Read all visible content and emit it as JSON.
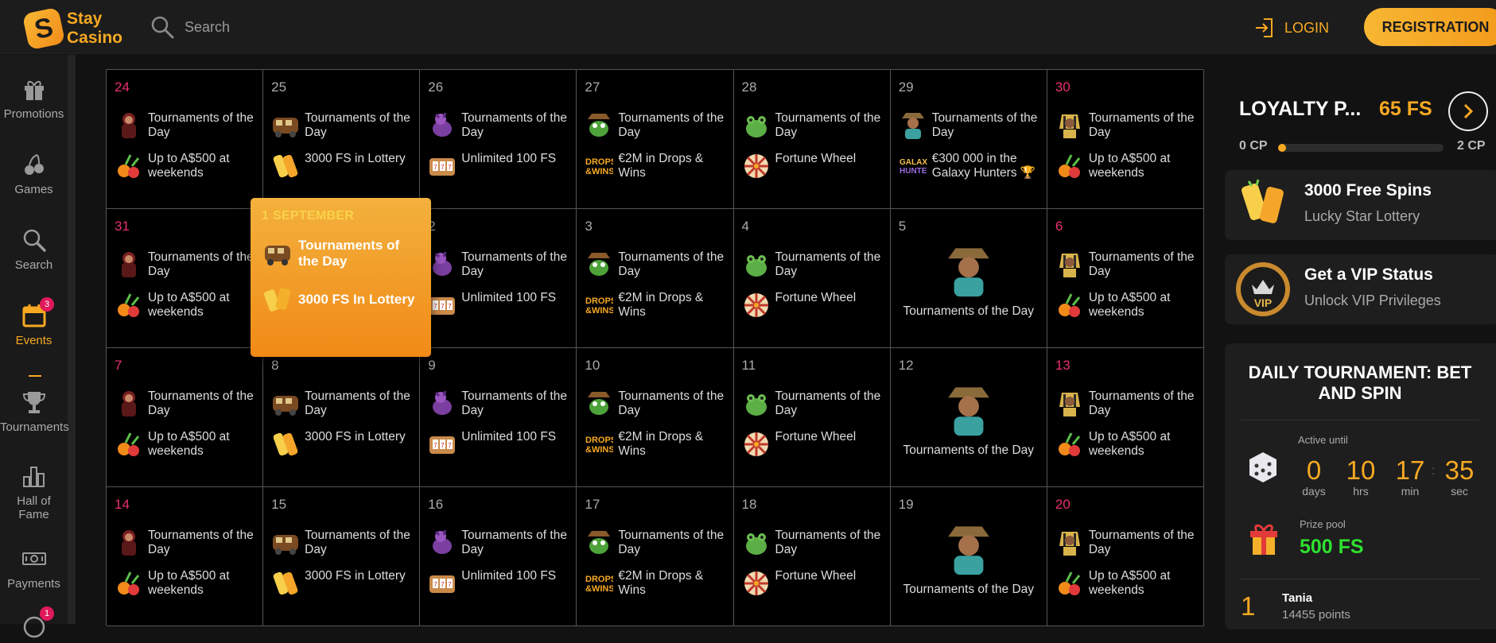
{
  "header": {
    "logo_line1": "Stay",
    "logo_line2": "Casino",
    "search_placeholder": "Search",
    "login_label": "LOGIN",
    "registration_label": "REGISTRATION"
  },
  "sidebar": {
    "items": [
      {
        "label": "Promotions",
        "icon": "gift-icon"
      },
      {
        "label": "Games",
        "icon": "cherries-icon"
      },
      {
        "label": "Search",
        "icon": "search-icon"
      },
      {
        "label": "Events",
        "icon": "calendar-icon",
        "badge": "3",
        "active": true
      },
      {
        "label": "Tournaments",
        "icon": "trophy-icon"
      },
      {
        "label": "Hall of Fame",
        "icon": "bar-chart-icon"
      },
      {
        "label": "Payments",
        "icon": "cash-icon"
      },
      {
        "label": "",
        "icon": "chat-icon",
        "badge": "1"
      }
    ]
  },
  "calendar": {
    "rows": [
      [
        {
          "day": "24",
          "weekend": true,
          "events": [
            {
              "label": "Tournaments of the Day",
              "icon": "warrior-icon"
            },
            {
              "label": "Up to A$500 at weekends",
              "icon": "fruit-bonus-icon"
            }
          ]
        },
        {
          "day": "25",
          "weekend": false,
          "events": [
            {
              "label": "Tournaments of the Day",
              "icon": "bus-icon"
            },
            {
              "label": "3000 FS in Lottery",
              "icon": "lottery-ticket-icon"
            }
          ]
        },
        {
          "day": "26",
          "weekend": false,
          "events": [
            {
              "label": "Tournaments of the Day",
              "icon": "dragon-icon"
            },
            {
              "label": "Unlimited 100 FS",
              "icon": "slot-machine-icon"
            }
          ]
        },
        {
          "day": "27",
          "weekend": false,
          "events": [
            {
              "label": "Tournaments of the Day",
              "icon": "frog-cowboy-icon"
            },
            {
              "label": "€2M in Drops & Wins",
              "icon": "drops-wins-icon"
            }
          ]
        },
        {
          "day": "28",
          "weekend": false,
          "events": [
            {
              "label": "Tournaments of the Day",
              "icon": "frog-icon"
            },
            {
              "label": "Fortune Wheel",
              "icon": "fortune-wheel-icon"
            }
          ]
        },
        {
          "day": "29",
          "weekend": false,
          "events": [
            {
              "label": "Tournaments of the Day",
              "icon": "cowboy-icon"
            },
            {
              "label": "€300 000 in the Galaxy Hunters 🏆",
              "icon": "galaxy-hunters-icon"
            }
          ]
        },
        {
          "day": "30",
          "weekend": true,
          "events": [
            {
              "label": "Tournaments of the Day",
              "icon": "pharaoh-icon"
            },
            {
              "label": "Up to A$500 at weekends",
              "icon": "fruit-bonus-icon"
            }
          ]
        }
      ],
      [
        {
          "day": "31",
          "weekend": true,
          "events": [
            {
              "label": "Tournaments of the Day",
              "icon": "warrior-icon"
            },
            {
              "label": "Up to A$500 at weekends",
              "icon": "fruit-bonus-icon"
            }
          ]
        },
        {
          "day": "1 SEPTEMBER",
          "weekend": false,
          "events": [
            {
              "label": "Tournaments of the Day",
              "icon": "bus-icon"
            },
            {
              "label": "3000 FS in Lottery",
              "icon": "lottery-ticket-icon"
            }
          ]
        },
        {
          "day": "2",
          "weekend": false,
          "events": [
            {
              "label": "Tournaments of the Day",
              "icon": "dragon-icon"
            },
            {
              "label": "Unlimited 100 FS",
              "icon": "slot-machine-icon"
            }
          ]
        },
        {
          "day": "3",
          "weekend": false,
          "events": [
            {
              "label": "Tournaments of the Day",
              "icon": "frog-cowboy-icon"
            },
            {
              "label": "€2M in Drops & Wins",
              "icon": "drops-wins-icon"
            }
          ]
        },
        {
          "day": "4",
          "weekend": false,
          "events": [
            {
              "label": "Tournaments of the Day",
              "icon": "frog-icon"
            },
            {
              "label": "Fortune Wheel",
              "icon": "fortune-wheel-icon"
            }
          ]
        },
        {
          "day": "5",
          "weekend": false,
          "solo": true,
          "events": [
            {
              "label": "Tournaments of the Day",
              "icon": "cowboy-icon"
            }
          ]
        },
        {
          "day": "6",
          "weekend": true,
          "events": [
            {
              "label": "Tournaments of the Day",
              "icon": "pharaoh-icon"
            },
            {
              "label": "Up to A$500 at weekends",
              "icon": "fruit-bonus-icon"
            }
          ]
        }
      ],
      [
        {
          "day": "7",
          "weekend": true,
          "events": [
            {
              "label": "Tournaments of the Day",
              "icon": "warrior-icon"
            },
            {
              "label": "Up to A$500 at weekends",
              "icon": "fruit-bonus-icon"
            }
          ]
        },
        {
          "day": "8",
          "weekend": false,
          "events": [
            {
              "label": "Tournaments of the Day",
              "icon": "bus-icon"
            },
            {
              "label": "3000 FS in Lottery",
              "icon": "lottery-ticket-icon"
            }
          ]
        },
        {
          "day": "9",
          "weekend": false,
          "events": [
            {
              "label": "Tournaments of the Day",
              "icon": "dragon-icon"
            },
            {
              "label": "Unlimited 100 FS",
              "icon": "slot-machine-icon"
            }
          ]
        },
        {
          "day": "10",
          "weekend": false,
          "events": [
            {
              "label": "Tournaments of the Day",
              "icon": "frog-cowboy-icon"
            },
            {
              "label": "€2M in Drops & Wins",
              "icon": "drops-wins-icon"
            }
          ]
        },
        {
          "day": "11",
          "weekend": false,
          "events": [
            {
              "label": "Tournaments of the Day",
              "icon": "frog-icon"
            },
            {
              "label": "Fortune Wheel",
              "icon": "fortune-wheel-icon"
            }
          ]
        },
        {
          "day": "12",
          "weekend": false,
          "solo": true,
          "events": [
            {
              "label": "Tournaments of the Day",
              "icon": "cowboy-icon"
            }
          ]
        },
        {
          "day": "13",
          "weekend": true,
          "events": [
            {
              "label": "Tournaments of the Day",
              "icon": "pharaoh-icon"
            },
            {
              "label": "Up to A$500 at weekends",
              "icon": "fruit-bonus-icon"
            }
          ]
        }
      ],
      [
        {
          "day": "14",
          "weekend": true,
          "events": [
            {
              "label": "Tournaments of the Day",
              "icon": "warrior-icon"
            },
            {
              "label": "Up to A$500 at weekends",
              "icon": "fruit-bonus-icon"
            }
          ]
        },
        {
          "day": "15",
          "weekend": false,
          "events": [
            {
              "label": "Tournaments of the Day",
              "icon": "bus-icon"
            },
            {
              "label": "3000 FS in Lottery",
              "icon": "lottery-ticket-icon"
            }
          ]
        },
        {
          "day": "16",
          "weekend": false,
          "events": [
            {
              "label": "Tournaments of the Day",
              "icon": "dragon-icon"
            },
            {
              "label": "Unlimited 100 FS",
              "icon": "slot-machine-icon"
            }
          ]
        },
        {
          "day": "17",
          "weekend": false,
          "events": [
            {
              "label": "Tournaments of the Day",
              "icon": "frog-cowboy-icon"
            },
            {
              "label": "€2M in Drops & Wins",
              "icon": "drops-wins-icon"
            }
          ]
        },
        {
          "day": "18",
          "weekend": false,
          "events": [
            {
              "label": "Tournaments of the Day",
              "icon": "frog-icon"
            },
            {
              "label": "Fortune Wheel",
              "icon": "fortune-wheel-icon"
            }
          ]
        },
        {
          "day": "19",
          "weekend": false,
          "solo": true,
          "events": [
            {
              "label": "Tournaments of the Day",
              "icon": "cowboy-icon"
            }
          ]
        },
        {
          "day": "20",
          "weekend": true,
          "events": [
            {
              "label": "Tournaments of the Day",
              "icon": "pharaoh-icon"
            },
            {
              "label": "Up to A$500 at weekends",
              "icon": "fruit-bonus-icon"
            }
          ]
        }
      ]
    ],
    "popup": {
      "date": "1 SEPTEMBER",
      "events": [
        {
          "label": "Tournaments of the Day",
          "icon": "bus-icon"
        },
        {
          "label": "3000 FS In Lottery",
          "icon": "lottery-ticket-icon"
        }
      ]
    }
  },
  "loyalty": {
    "title": "LOYALTY P...",
    "fs": "65 FS",
    "cp_min": "0 CP",
    "cp_max": "2 CP",
    "progress": 0.05
  },
  "promo_cards": [
    {
      "title": "3000 Free Spins",
      "subtitle": "Lucky Star Lottery",
      "icon": "lottery-tickets-icon"
    },
    {
      "title": "Get a VIP Status",
      "subtitle": "Unlock VIP Privileges",
      "icon": "vip-badge-icon"
    }
  ],
  "tournament": {
    "title": "DAILY TOURNAMENT: BET AND SPIN",
    "active_until_label": "Active until",
    "countdown": [
      {
        "value": "0",
        "unit": "days"
      },
      {
        "value": "10",
        "unit": "hrs"
      },
      {
        "value": "17",
        "unit": "min"
      },
      {
        "value": "35",
        "unit": "sec"
      }
    ],
    "prize_pool_label": "Prize pool",
    "prize_pool_value": "500 FS",
    "leader": {
      "rank": "1",
      "name": "Tania",
      "points": "14455 points"
    }
  },
  "colors": {
    "accent": "#f7a922",
    "weekend_day": "#e8306a",
    "prize_green": "#2ee02e",
    "badge": "#e0195a"
  }
}
